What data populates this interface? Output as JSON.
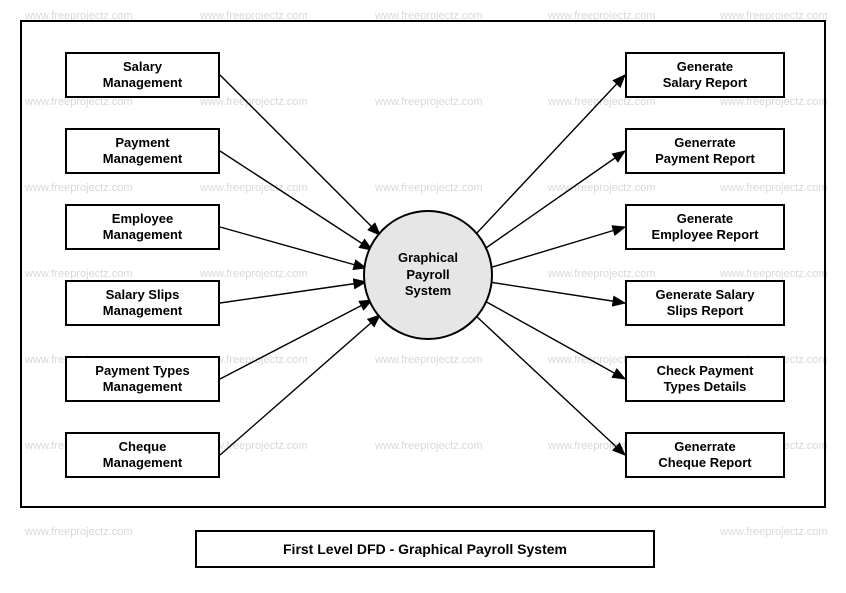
{
  "watermark": "www.freeprojectz.com",
  "center": {
    "label": "Graphical\nPayroll\nSystem"
  },
  "left_boxes": [
    {
      "label": "Salary\nManagement"
    },
    {
      "label": "Payment\nManagement"
    },
    {
      "label": "Employee\nManagement"
    },
    {
      "label": "Salary Slips\nManagement"
    },
    {
      "label": "Payment Types\nManagement"
    },
    {
      "label": "Cheque\nManagement"
    }
  ],
  "right_boxes": [
    {
      "label": "Generate\nSalary Report"
    },
    {
      "label": "Generrate\nPayment Report"
    },
    {
      "label": "Generate\nEmployee Report"
    },
    {
      "label": "Generate Salary\nSlips Report"
    },
    {
      "label": "Check Payment\nTypes Details"
    },
    {
      "label": "Generrate\nCheque Report"
    }
  ],
  "title": "First Level DFD - Graphical Payroll System"
}
